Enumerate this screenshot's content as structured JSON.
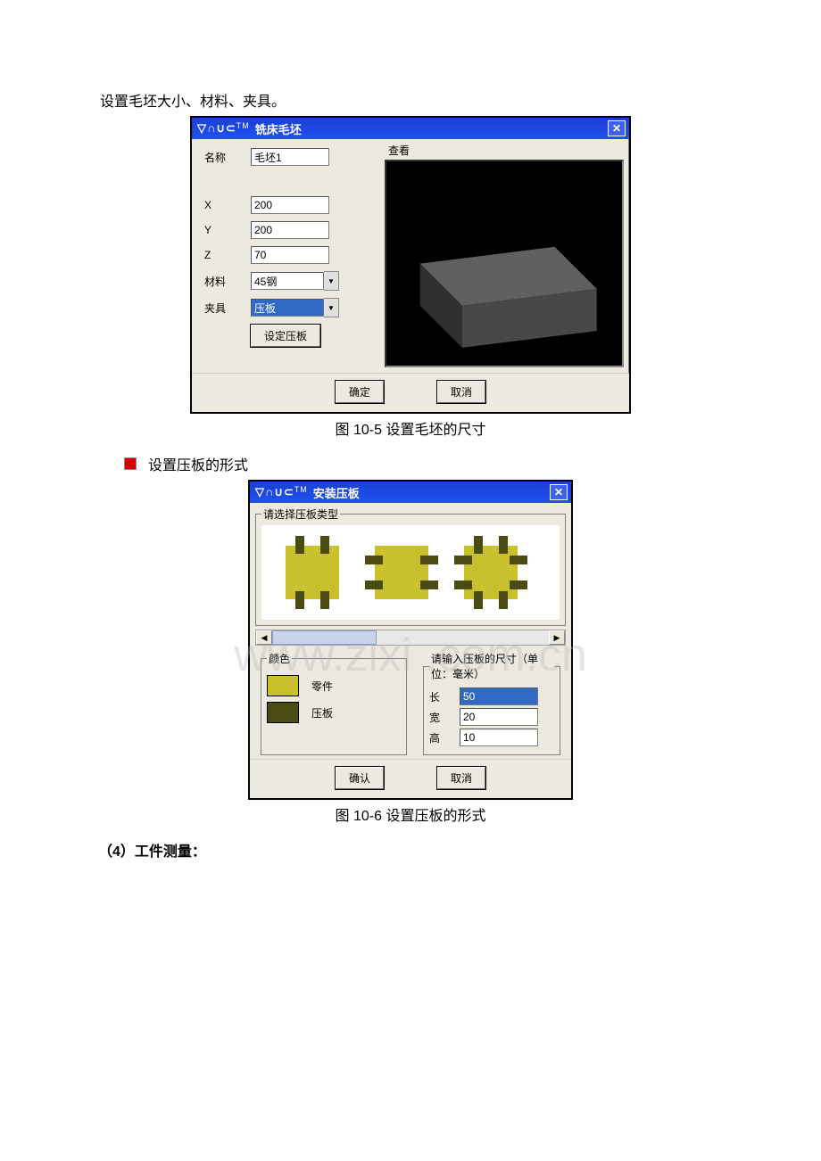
{
  "page": {
    "intro": "设置毛坯大小、材料、夹具。",
    "caption1": "图 10-5  设置毛坯的尺寸",
    "bullet2": "设置压板的形式",
    "caption2": "图 10-6  设置压板的形式",
    "section4": "（4）工件测量：",
    "watermark": "www.zixi .com.cn"
  },
  "dlg1": {
    "logo": "▽∩∪⊂",
    "logo_tm": "TM",
    "title": "铣床毛坯",
    "close_glyph": "✕",
    "name_label": "名称",
    "name_value": "毛坯1",
    "x_label": "X",
    "x_value": "200",
    "y_label": "Y",
    "y_value": "200",
    "z_label": "Z",
    "z_value": "70",
    "material_label": "材料",
    "material_value": "45钢",
    "fixture_label": "夹具",
    "fixture_value": "压板",
    "set_clamp_btn": "设定压板",
    "preview_label": "查看",
    "ok_btn": "确定",
    "cancel_btn": "取消"
  },
  "dlg2": {
    "logo": "▽∩∪⊂",
    "logo_tm": "TM",
    "title": "安装压板",
    "close_glyph": "✕",
    "type_legend": "请选择压板类型",
    "scroll_left": "◀",
    "scroll_right": "▶",
    "color_legend": "颜色",
    "part_label": "零件",
    "clamp_label": "压板",
    "dims_legend": "请输入压板的尺寸（单位：毫米）",
    "len_label": "长",
    "len_value": "50",
    "wid_label": "宽",
    "wid_value": "20",
    "hgt_label": "高",
    "hgt_value": "10",
    "ok_btn": "确认",
    "cancel_btn": "取消"
  }
}
